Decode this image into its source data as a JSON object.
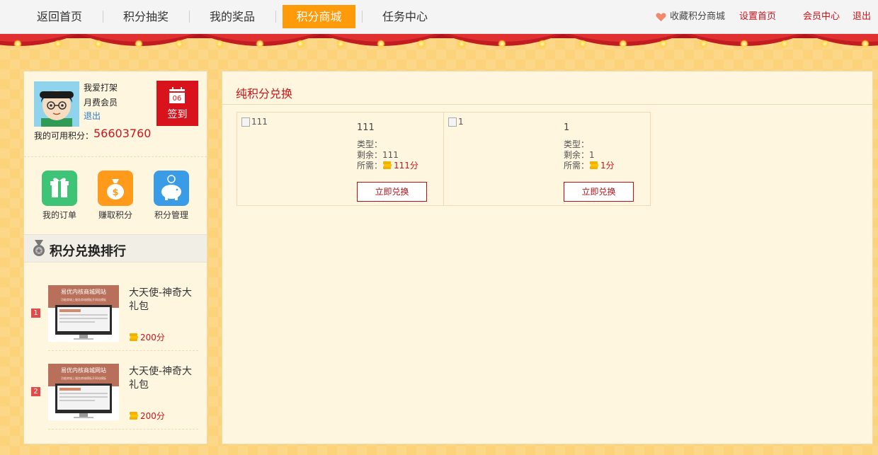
{
  "nav": {
    "items": [
      {
        "label": "返回首页",
        "active": false
      },
      {
        "label": "积分抽奖",
        "active": false
      },
      {
        "label": "我的奖品",
        "active": false
      },
      {
        "label": "积分商城",
        "active": true
      },
      {
        "label": "任务中心",
        "active": false
      }
    ],
    "favorite": "收藏积分商城",
    "set_home": "设置首页",
    "member_center": "会员中心",
    "logout": "退出"
  },
  "user": {
    "name": "我爱打架",
    "level": "月费会员",
    "logout": "退出",
    "points_label": "我的可用积分：",
    "points": "56603760",
    "signin_day": "06",
    "signin_label": "签到"
  },
  "quick_links": [
    {
      "label": "我的订单",
      "icon": "gift-icon",
      "color": "#3dc476"
    },
    {
      "label": "赚取积分",
      "icon": "money-bag-icon",
      "color": "#ff9a1a"
    },
    {
      "label": "积分管理",
      "icon": "piggy-bank-icon",
      "color": "#3a9ce6"
    }
  ],
  "ranking": {
    "title": "积分兑换排行",
    "items": [
      {
        "rank": "1",
        "name": "大天使-神奇大礼包",
        "price": "200分",
        "thumb_title": "易优内核商城网站",
        "thumb_sub": "功能商城上服务商城模板开网站模板"
      },
      {
        "rank": "2",
        "name": "大天使-神奇大礼包",
        "price": "200分",
        "thumb_title": "易优内核商城网站",
        "thumb_sub": "功能商城上服务商城模板开网站模板"
      }
    ]
  },
  "main": {
    "section_title": "纯积分兑换",
    "products": [
      {
        "img_alt": "111",
        "name": "111",
        "type_label": "类型：",
        "remain_label": "剩余：",
        "remain": "111",
        "cost_label": "所需：",
        "cost": "111分",
        "button": "立即兑换"
      },
      {
        "img_alt": "1",
        "name": "1",
        "type_label": "类型：",
        "remain_label": "剩余：",
        "remain": "1",
        "cost_label": "所需：",
        "cost": "1分",
        "button": "立即兑换"
      }
    ]
  },
  "colors": {
    "accent_red": "#c8161d",
    "nav_active": "#ff9a0a",
    "panel_bg": "#fff6e0"
  }
}
